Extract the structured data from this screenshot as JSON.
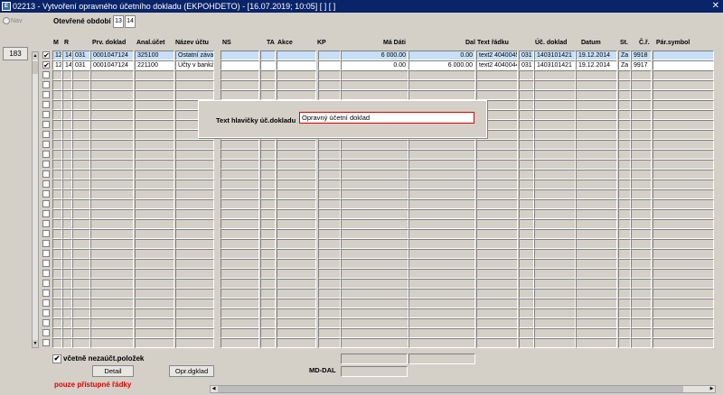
{
  "window": {
    "title": "02213 - Vytvoření opravného účetního dokladu (EKPOHDETO) - [16.07.2019; 10:05]  [ ]  [ ]",
    "close_symbol": "✕",
    "app_icon_text": "E"
  },
  "nav_label": "Nav",
  "record_count": "183",
  "period": {
    "label": "Otevřené období",
    "values": [
      "13",
      "14"
    ]
  },
  "columns": [
    "M",
    "R",
    "Prv. doklad",
    "Anal.účet",
    "Název účtu",
    "NS",
    "TA",
    "Akce",
    "KP",
    "Má Dáti",
    "Dal",
    "Text řádku",
    "Úč. doklad",
    "Datum",
    "St.",
    "Č.ř.",
    "Pár.symbol"
  ],
  "rows": [
    [
      "12",
      "14",
      "031",
      "0001047124",
      "325100",
      "Ostatní závaz",
      "",
      "",
      "",
      "",
      "6 000.00",
      "0.00",
      "text2 40400455",
      "031",
      "1403101421",
      "19.12.2014",
      "Za",
      "9918",
      ""
    ],
    [
      "12",
      "14",
      "031",
      "0001047124",
      "221100",
      "Účty v bankác",
      "",
      "",
      "",
      "",
      "0.00",
      "6 000.00",
      "text2 40400445",
      "031",
      "1403101421",
      "19.12.2014",
      "Za",
      "9917",
      ""
    ]
  ],
  "row_checked": [
    true,
    true
  ],
  "dialog": {
    "label": "Text hlavičky úč.dokladu",
    "value": "Opravný účetní doklad"
  },
  "include_checkbox": {
    "label": "včetně nezaúčt.položek",
    "checked": true
  },
  "buttons": {
    "detail": "Detail",
    "opr_dgkl": "Opr.dgklad"
  },
  "md_dal_label": "MD-DAL",
  "status_note": "pouze přístupné řádky",
  "colors": {
    "titlebar": "#0a246a",
    "selected_row": "#c7dff7",
    "warning_text": "#e00000",
    "dialog_input_border": "#d00000"
  }
}
